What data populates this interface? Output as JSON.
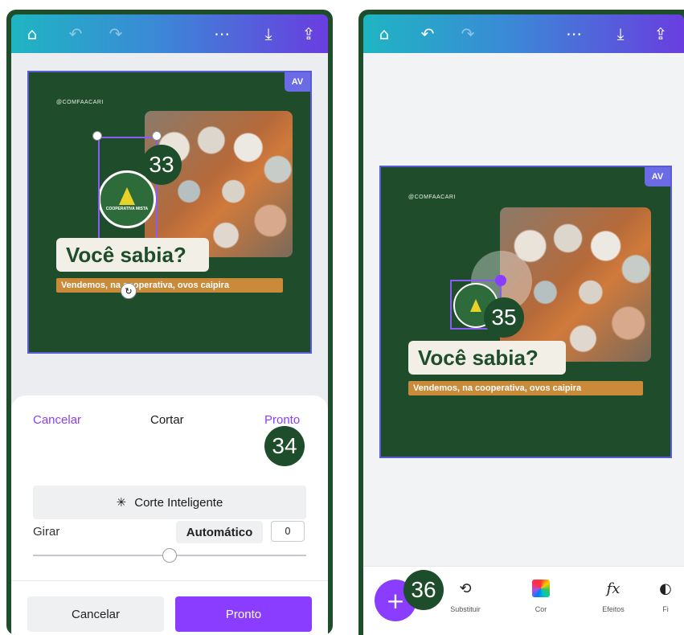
{
  "left_panel": {
    "topbar": {
      "icons": [
        "home-icon",
        "undo-icon",
        "redo-icon",
        "more-icon",
        "download-icon",
        "share-icon"
      ]
    },
    "design": {
      "badge": "AV",
      "handle": "@COMFAACARI",
      "logo_text": "COOPERATIVA MISTA",
      "title": "Você sabia?",
      "subtitle": "Vendemos, na cooperativa, ovos caipira",
      "step_marker": "33"
    },
    "crop_sheet": {
      "cancel_link": "Cancelar",
      "heading": "Cortar",
      "done_link": "Pronto",
      "step_marker": "34",
      "smart_crop_label": "Corte Inteligente",
      "rotate_label": "Girar",
      "auto_label": "Automático",
      "rotate_value": "0",
      "rotate_fraction": 0.5,
      "cancel_button": "Cancelar",
      "done_button": "Pronto"
    }
  },
  "right_panel": {
    "design": {
      "badge": "AV",
      "handle": "@COMFAACARI",
      "title": "Você sabia?",
      "subtitle": "Vendemos, na cooperativa, ovos caipira",
      "step_marker": "35"
    },
    "toolbar": {
      "add_step_marker": "36",
      "tools": [
        {
          "label": "Substituir",
          "icon": "replace-icon"
        },
        {
          "label": "Cor",
          "icon": "color-icon"
        },
        {
          "label": "Efeitos",
          "icon": "fx-icon"
        },
        {
          "label": "Fi",
          "icon": "filter-icon"
        }
      ]
    }
  },
  "colors": {
    "accent": "#8b3dff",
    "design_green": "#1f4d2b",
    "selection": "#5b5bd6"
  }
}
